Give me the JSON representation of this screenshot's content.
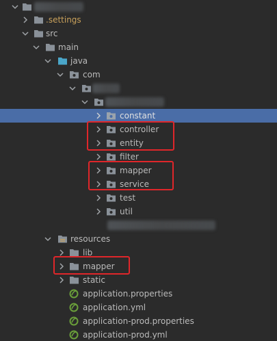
{
  "tree": {
    "root_name": "",
    "items": {
      "settings": ".settings",
      "src": "src",
      "main": "main",
      "java": "java",
      "com": "com",
      "constant": "constant",
      "controller": "controller",
      "entity": "entity",
      "filter": "filter",
      "mapper": "mapper",
      "service": "service",
      "test": "test",
      "util": "util",
      "resources": "resources",
      "lib": "lib",
      "resources_mapper": "mapper",
      "static": "static",
      "application_properties": "application.properties",
      "application_yml": "application.yml",
      "application_prod_properties": "application-prod.properties",
      "application_prod_yml": "application-prod.yml"
    }
  },
  "colors": {
    "background": "#2b2b2b",
    "selection": "#4a6da7",
    "text": "#bbbbbb",
    "excluded_text": "#c9a15b",
    "highlight_box": "#e0262a",
    "folder": "#8a9199",
    "source_folder": "#4aa6c9",
    "spring_file": "#6a9f3a"
  },
  "icons": {
    "collapsed": "chevron-right-icon",
    "expanded": "chevron-down-icon",
    "folder": "folder-icon",
    "package": "package-icon",
    "source_folder": "source-folder-icon",
    "resources_folder": "resources-folder-icon",
    "spring_config": "spring-config-file-icon"
  }
}
